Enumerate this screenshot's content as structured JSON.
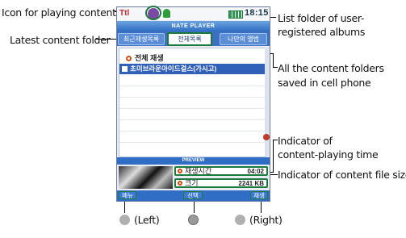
{
  "phone": {
    "status": {
      "signal": "Ttl",
      "time": "18:15"
    },
    "title": "NATE PLAYER",
    "tabs": [
      "최근재생목록",
      "전체목록",
      "나만의 앨범"
    ],
    "list": {
      "header": "전체 재생",
      "selected_item": "초미브라운아이드걸스(가시고)"
    },
    "preview_label": "PREVIEW",
    "playing_time": {
      "label": "재생시간",
      "value": "04:02"
    },
    "file_size": {
      "label": "크기",
      "value": "2241 KB"
    },
    "softkeys": {
      "left": "메뉴",
      "center": "선택",
      "right": "재생"
    }
  },
  "annotations": {
    "playing_icon": "Icon for playing contents",
    "latest_folder": "Latest content folder",
    "user_albums_1": "List folder of user-",
    "user_albums_2": "registered albums",
    "all_folders_1": "All the content folders",
    "all_folders_2": "saved in cell phone",
    "playing_time_1": "Indicator of",
    "playing_time_2": "content-playing time",
    "file_size": "Indicator of content file size"
  },
  "keys": {
    "left": "(Left)",
    "right": "(Right)"
  },
  "colors": {
    "callout_green": "#1d7a3d",
    "bar_blue": "#2f6ec4",
    "accent_red": "#d04e12"
  }
}
